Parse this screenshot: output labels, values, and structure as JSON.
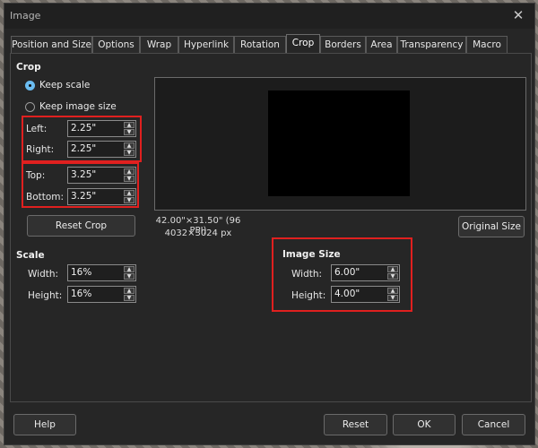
{
  "window": {
    "title": "Image",
    "close_icon": "close-icon"
  },
  "tabs": [
    {
      "label": "Position and Size"
    },
    {
      "label": "Options"
    },
    {
      "label": "Wrap"
    },
    {
      "label": "Hyperlink"
    },
    {
      "label": "Rotation"
    },
    {
      "label": "Crop",
      "active": true
    },
    {
      "label": "Borders"
    },
    {
      "label": "Area"
    },
    {
      "label": "Transparency"
    },
    {
      "label": "Macro"
    }
  ],
  "crop": {
    "heading": "Crop",
    "keep_scale": {
      "label": "Keep scale",
      "checked": true
    },
    "keep_image_size": {
      "label": "Keep image size",
      "checked": false
    },
    "left": {
      "label": "Left:",
      "value": "2.25\""
    },
    "right": {
      "label": "Right:",
      "value": "2.25\""
    },
    "top": {
      "label": "Top:",
      "value": "3.25\""
    },
    "bottom": {
      "label": "Bottom:",
      "value": "3.25\""
    },
    "reset_crop_label": "Reset Crop"
  },
  "preview": {
    "dimensions_text": "42.00\"×31.50\" (96 PPI)",
    "pixels_text": "4032×3024 px",
    "original_size_label": "Original Size"
  },
  "scale": {
    "heading": "Scale",
    "width": {
      "label": "Width:",
      "value": "16%"
    },
    "height": {
      "label": "Height:",
      "value": "16%"
    }
  },
  "image_size": {
    "heading": "Image Size",
    "width": {
      "label": "Width:",
      "value": "6.00\""
    },
    "height": {
      "label": "Height:",
      "value": "4.00\""
    }
  },
  "footer": {
    "help_label": "Help",
    "reset_label": "Reset",
    "ok_label": "OK",
    "cancel_label": "Cancel"
  },
  "colors": {
    "dialog_bg": "#262626",
    "highlight_red": "#e0201f",
    "radio_accent": "#6bbcf0"
  }
}
